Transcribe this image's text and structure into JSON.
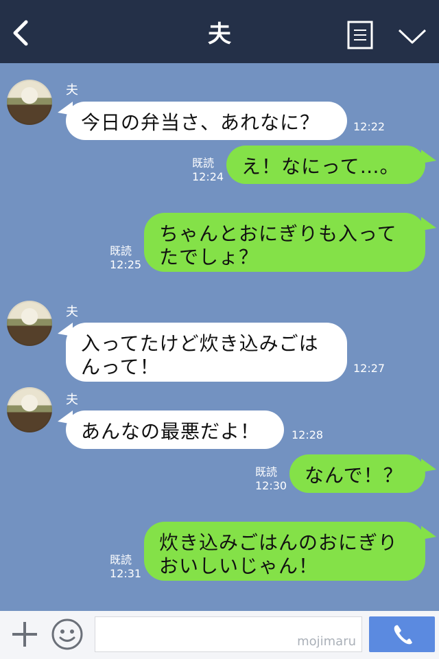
{
  "header": {
    "title": "夫"
  },
  "messages": [
    {
      "sender": "夫",
      "text": "今日の弁当さ、あれなに？",
      "time": "12:22"
    },
    {
      "read": "既読",
      "time": "12:24",
      "text": "え！なにって…。"
    },
    {
      "read": "既読",
      "time": "12:25",
      "text_lines": [
        "ちゃんとおにぎりも入って",
        "たでしょ？"
      ]
    },
    {
      "sender": "夫",
      "text_lines": [
        "入ってたけど炊き込みごは",
        "んって！"
      ],
      "time": "12:27"
    },
    {
      "sender": "夫",
      "text": "あんなの最悪だよ！",
      "time": "12:28"
    },
    {
      "read": "既読",
      "time": "12:30",
      "text": "なんで！？"
    },
    {
      "read": "既読",
      "time": "12:31",
      "text_lines": [
        "炊き込みごはんのおにぎり",
        "おいしいじゃん！"
      ]
    }
  ],
  "input": {
    "watermark": "mojimaru"
  },
  "colors": {
    "header_bg": "#243048",
    "chat_bg": "#7392c1",
    "incoming_bubble": "#ffffff",
    "outgoing_bubble": "#84e148",
    "call_button": "#5b8ae0"
  },
  "icons": [
    "back-chevron-icon",
    "menu-icon",
    "chevron-down-icon",
    "plus-icon",
    "smiley-icon",
    "phone-icon"
  ]
}
